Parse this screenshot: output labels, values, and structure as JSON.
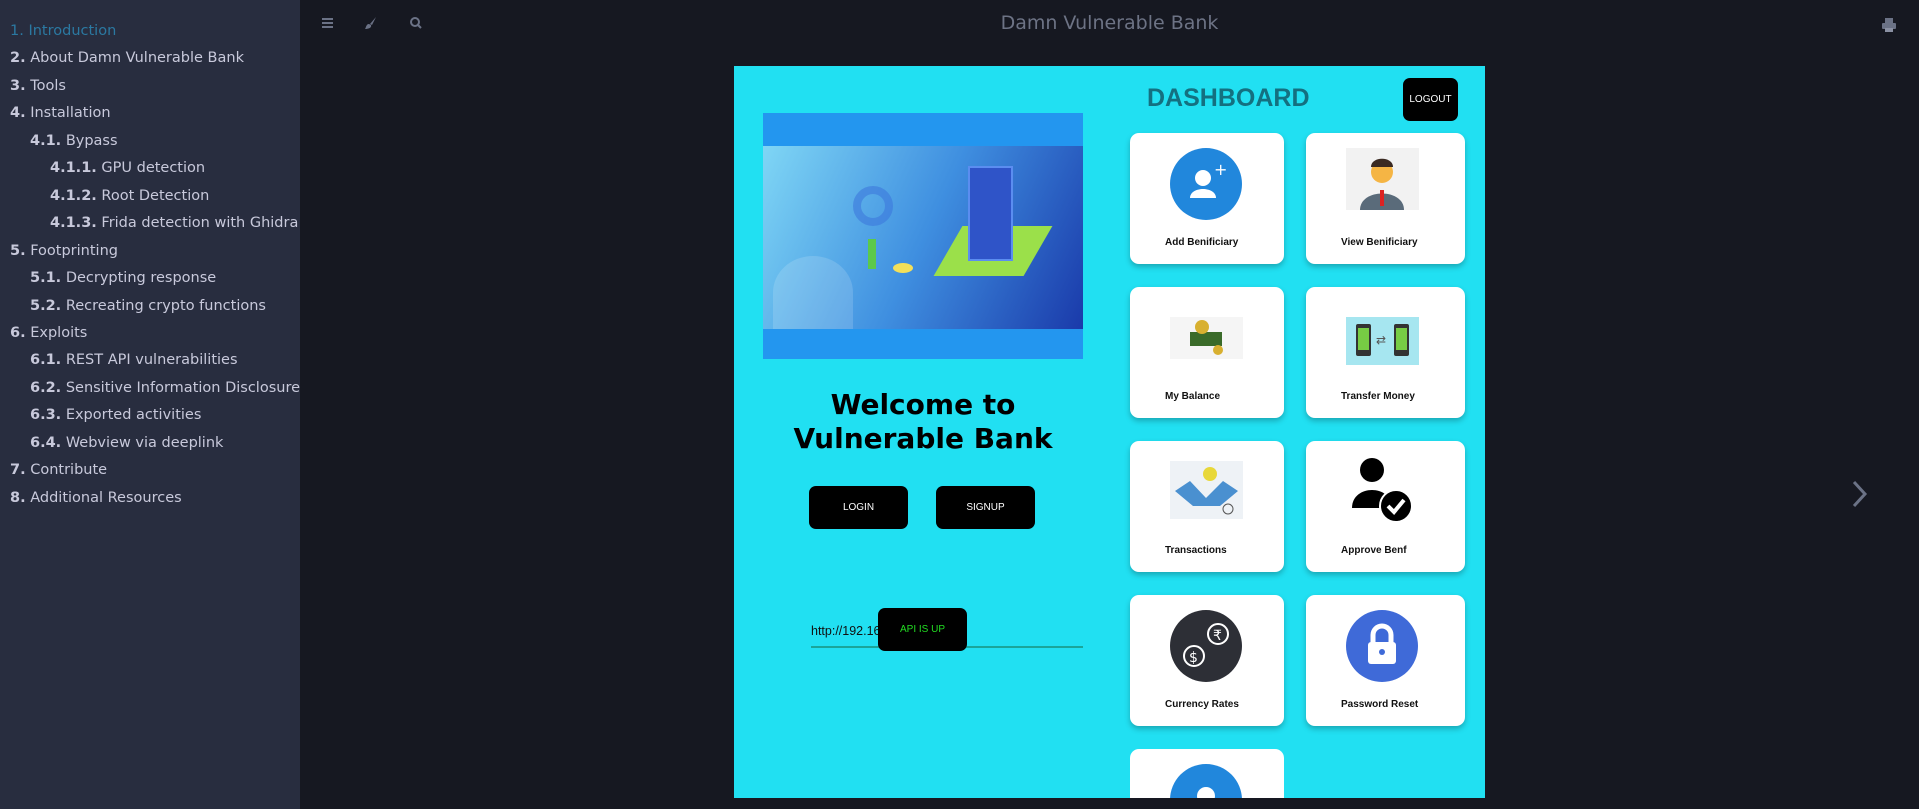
{
  "sidebar": {
    "items": [
      {
        "num": "1.",
        "label": "Introduction",
        "level": 0,
        "active": true
      },
      {
        "num": "2.",
        "label": "About Damn Vulnerable Bank",
        "level": 0
      },
      {
        "num": "3.",
        "label": "Tools",
        "level": 0
      },
      {
        "num": "4.",
        "label": "Installation",
        "level": 0
      },
      {
        "num": "4.1.",
        "label": "Bypass",
        "level": 1
      },
      {
        "num": "4.1.1.",
        "label": "GPU detection",
        "level": 2
      },
      {
        "num": "4.1.2.",
        "label": "Root Detection",
        "level": 2
      },
      {
        "num": "4.1.3.",
        "label": "Frida detection with Ghidra",
        "level": 2
      },
      {
        "num": "5.",
        "label": "Footprinting",
        "level": 0
      },
      {
        "num": "5.1.",
        "label": "Decrypting response",
        "level": 1
      },
      {
        "num": "5.2.",
        "label": "Recreating crypto functions",
        "level": 1
      },
      {
        "num": "6.",
        "label": "Exploits",
        "level": 0
      },
      {
        "num": "6.1.",
        "label": "REST API vulnerabilities",
        "level": 1
      },
      {
        "num": "6.2.",
        "label": "Sensitive Information Disclosure",
        "level": 1
      },
      {
        "num": "6.3.",
        "label": "Exported activities",
        "level": 1
      },
      {
        "num": "6.4.",
        "label": "Webview via deeplink",
        "level": 1
      },
      {
        "num": "7.",
        "label": "Contribute",
        "level": 0
      },
      {
        "num": "8.",
        "label": "Additional Resources",
        "level": 0
      }
    ]
  },
  "header": {
    "title": "Damn Vulnerable Bank",
    "icons": [
      "menu-icon",
      "brush-icon",
      "search-icon",
      "print-icon"
    ]
  },
  "app": {
    "welcome": "Welcome to Vulnerable Bank",
    "login": "LOGIN",
    "signup": "SIGNUP",
    "api_url": "http://192.168.43.130:3000",
    "api_status": "API IS UP",
    "api_status_color": "#22dd22",
    "dashboard_title": "DASHBOARD",
    "logout": "LOGOUT",
    "cards": [
      "Add Benificiary",
      "View Benificiary",
      "My Balance",
      "Transfer Money",
      "Transactions",
      "Approve Benf",
      "Currency Rates",
      "Password Reset",
      ""
    ]
  },
  "colors": {
    "accent": "#2b79a2",
    "app_bg": "#21e0f2"
  }
}
